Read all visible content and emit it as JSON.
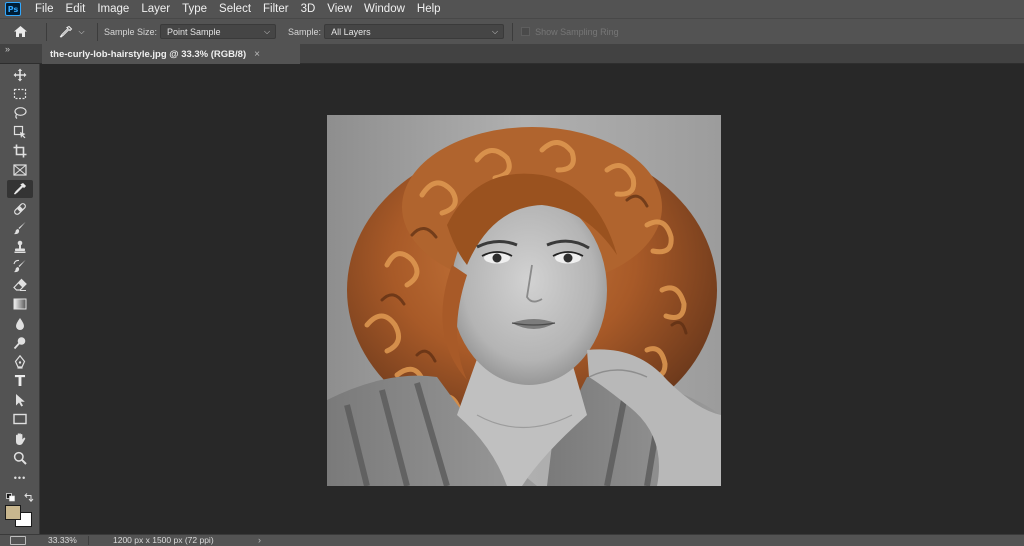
{
  "app": {
    "logo_text": "Ps"
  },
  "menu": {
    "items": [
      "File",
      "Edit",
      "Image",
      "Layer",
      "Type",
      "Select",
      "Filter",
      "3D",
      "View",
      "Window",
      "Help"
    ]
  },
  "options": {
    "home_icon": "home-icon",
    "tool_icon": "eyedropper-icon",
    "sample_size_label": "Sample Size:",
    "sample_size_value": "Point Sample",
    "sample_label": "Sample:",
    "sample_value": "All Layers",
    "show_ring_label": "Show Sampling Ring"
  },
  "tab": {
    "title": "the-curly-lob-hairstyle.jpg @ 33.3% (RGB/8)",
    "close": "×",
    "collapse": "»"
  },
  "toolbar": {
    "collapse": "»",
    "active_tool": "eyedropper-tool",
    "tools": [
      "move-tool",
      "marquee-tool",
      "lasso-tool",
      "quick-select-tool",
      "crop-tool",
      "frame-tool",
      "eyedropper-tool",
      "healing-brush-tool",
      "brush-tool",
      "clone-stamp-tool",
      "history-brush-tool",
      "eraser-tool",
      "gradient-tool",
      "blur-tool",
      "dodge-tool",
      "pen-tool",
      "type-tool",
      "path-select-tool",
      "rectangle-tool",
      "hand-tool",
      "zoom-tool",
      "more-tools"
    ],
    "type_glyph": "T",
    "more_glyph": "•••",
    "foreground_color": "#c8b68e",
    "background_color": "#ffffff"
  },
  "status": {
    "zoom": "33.33%",
    "doc_info": "1200 px x 1500 px (72 ppi)",
    "arrow": "›"
  },
  "colors": {
    "panel": "#535353",
    "canvas_bg": "#282828",
    "accent": "#31a8ff"
  }
}
